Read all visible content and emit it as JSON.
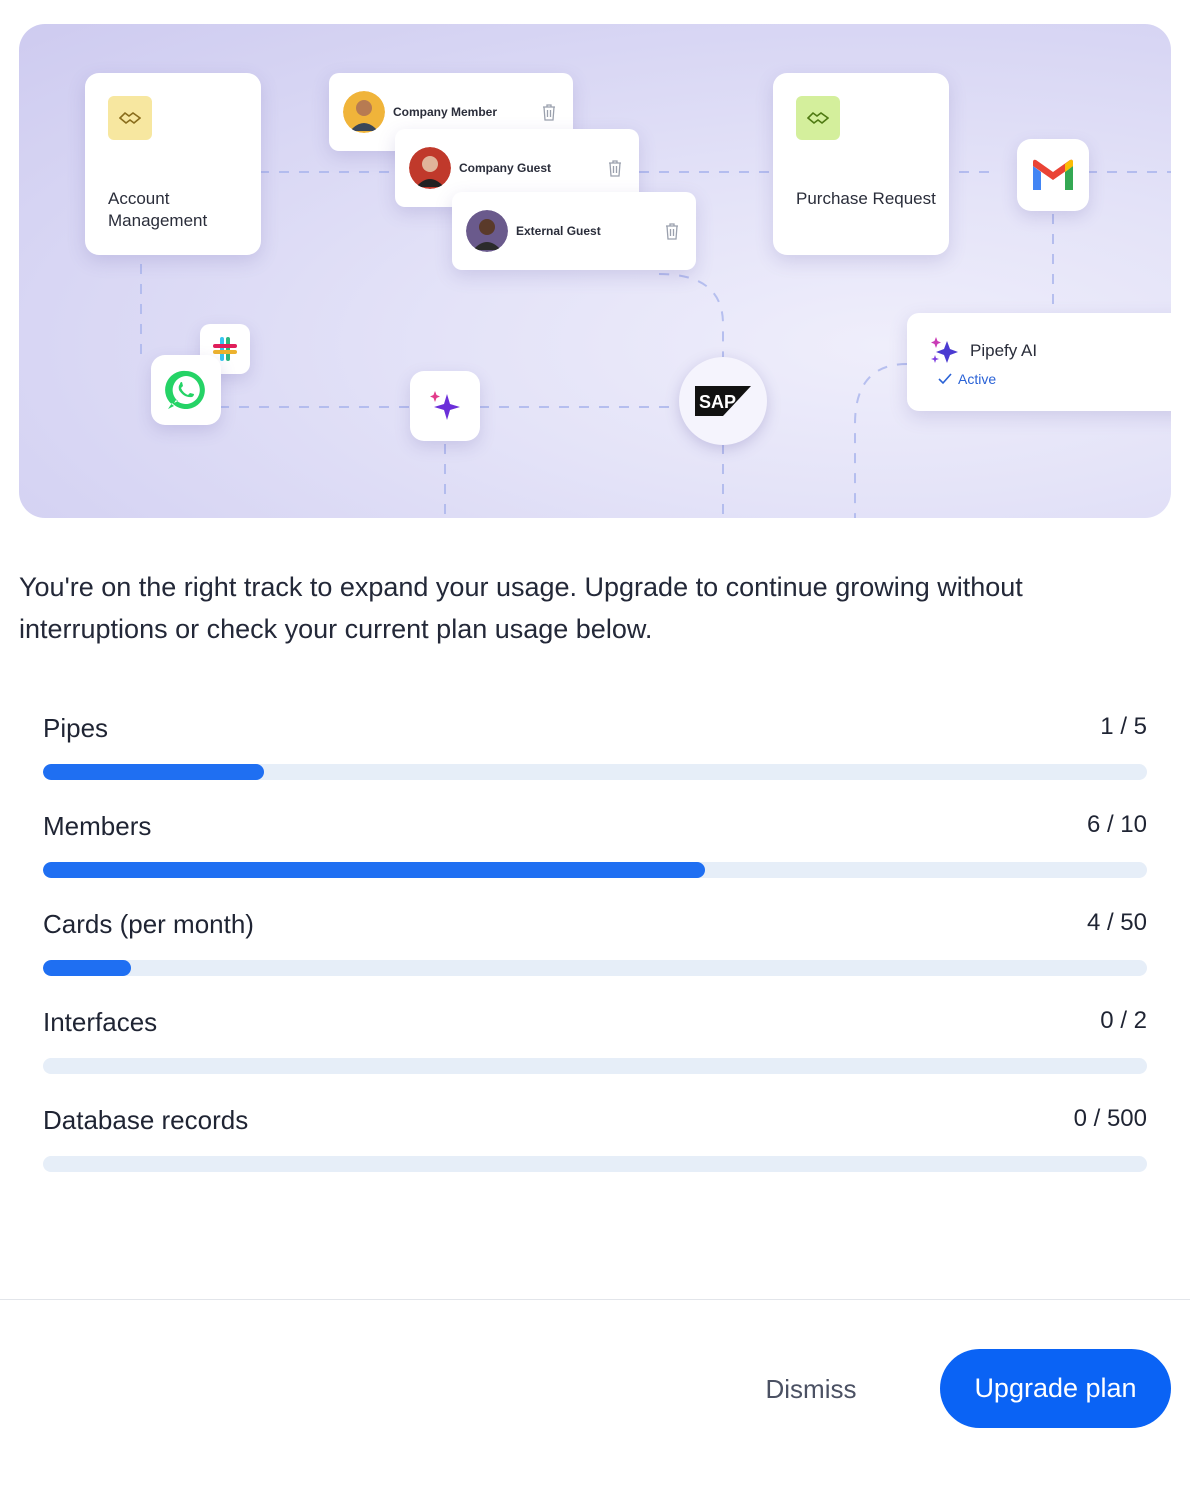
{
  "hero": {
    "process_cards": [
      {
        "title": "Account Management"
      },
      {
        "title": "Purchase Request"
      }
    ],
    "member_cards": [
      {
        "name": "Company Member"
      },
      {
        "name": "Company Guest"
      },
      {
        "name": "External Guest"
      }
    ],
    "integrations": [
      "whatsapp-icon",
      "slack-icon",
      "sparkle-icon",
      "sap-logo",
      "gmail-icon"
    ],
    "sap_label": "SAP",
    "ai_card": {
      "title": "Pipefy AI",
      "status": "Active"
    }
  },
  "intro_text": "You're on the right track to expand your usage. Upgrade to continue growing without interruptions or check your current plan usage below.",
  "usage": [
    {
      "label": "Pipes",
      "used": 1,
      "limit": 5,
      "display": "1 / 5"
    },
    {
      "label": "Members",
      "used": 6,
      "limit": 10,
      "display": "6 / 10"
    },
    {
      "label": "Cards (per month)",
      "used": 4,
      "limit": 50,
      "display": "4 / 50"
    },
    {
      "label": "Interfaces",
      "used": 0,
      "limit": 2,
      "display": "0 / 2"
    },
    {
      "label": "Database records",
      "used": 0,
      "limit": 500,
      "display": "0 / 500"
    }
  ],
  "footer": {
    "dismiss_label": "Dismiss",
    "upgrade_label": "Upgrade plan"
  },
  "colors": {
    "primary": "#0a63f5",
    "progress_fill": "#1f6ff2",
    "progress_track": "#e6eef8"
  }
}
